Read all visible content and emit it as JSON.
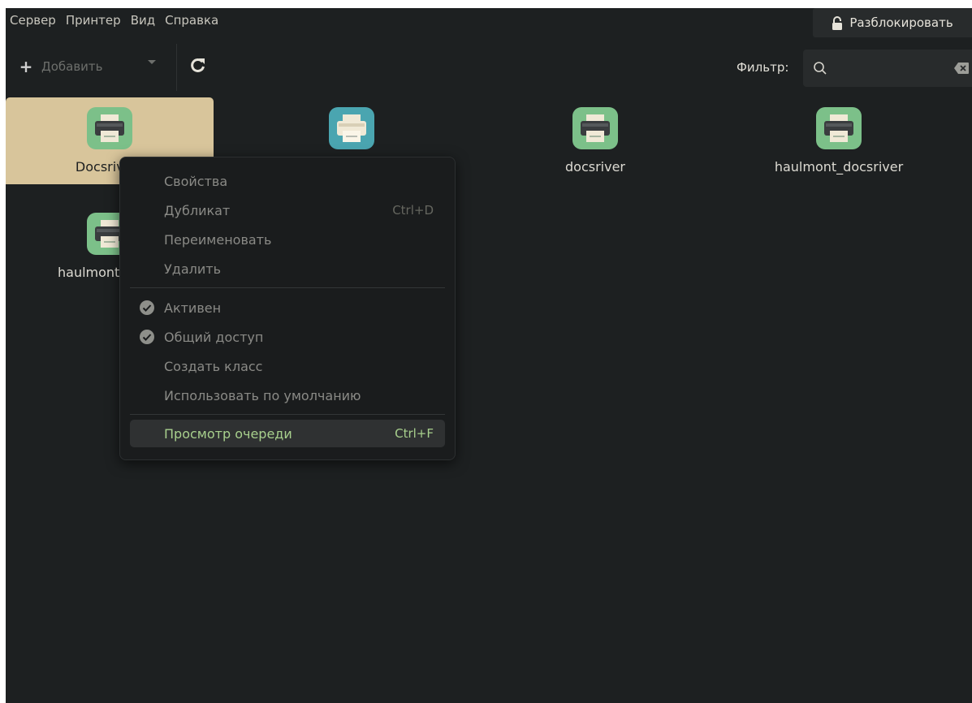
{
  "menubar": {
    "items": [
      "Сервер",
      "Принтер",
      "Вид",
      "Справка"
    ],
    "unlock_label": "Разблокировать"
  },
  "toolbar": {
    "add_label": "Добавить",
    "filter_label": "Фильтр:",
    "filter_value": ""
  },
  "printers": [
    {
      "label": "Docsriver_",
      "selected": true
    },
    {
      "label": "",
      "selected": false
    },
    {
      "label": "docsriver",
      "selected": false
    },
    {
      "label": "haulmont_docsriver",
      "selected": false
    },
    {
      "label": "haulmont_docsr",
      "selected": false
    }
  ],
  "context_menu": {
    "items": [
      {
        "label": "Свойства",
        "shortcut": "",
        "checked": false
      },
      {
        "label": "Дубликат",
        "shortcut": "Ctrl+D",
        "checked": false
      },
      {
        "label": "Переименовать",
        "shortcut": "",
        "checked": false
      },
      {
        "label": "Удалить",
        "shortcut": "",
        "checked": false
      },
      {
        "label": "Активен",
        "shortcut": "",
        "checked": true
      },
      {
        "label": "Общий доступ",
        "shortcut": "",
        "checked": true
      },
      {
        "label": "Создать класс",
        "shortcut": "",
        "checked": false
      },
      {
        "label": "Использовать по умолчанию",
        "shortcut": "",
        "checked": false
      },
      {
        "label": "Просмотр очереди",
        "shortcut": "Ctrl+F",
        "checked": false,
        "highlighted": true
      }
    ]
  },
  "colors": {
    "background": "#1d2021",
    "selection": "#d8c59b",
    "accent_green": "#a8d08d",
    "printer_green": "#7cc089",
    "printer_teal": "#4aa5b0"
  }
}
